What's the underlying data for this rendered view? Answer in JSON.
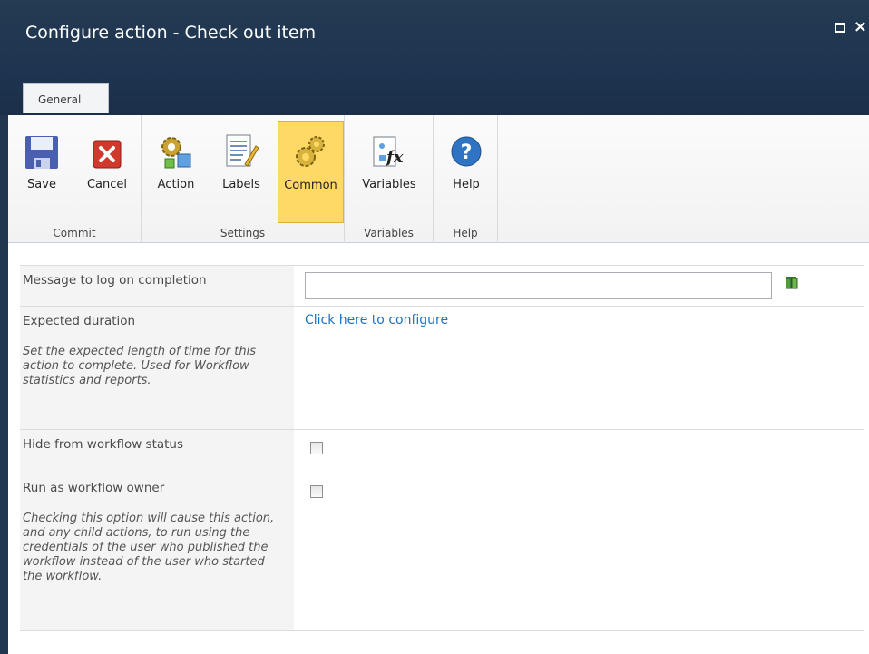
{
  "dialog": {
    "title": "Configure action - Check out item",
    "tab_label": "General",
    "window_controls": {
      "maximize": "□",
      "close": "×"
    }
  },
  "ribbon": {
    "groups": [
      {
        "label": "Commit",
        "buttons": [
          {
            "label": "Save",
            "icon": "save-icon"
          },
          {
            "label": "Cancel",
            "icon": "cancel-icon"
          }
        ]
      },
      {
        "label": "Settings",
        "buttons": [
          {
            "label": "Action",
            "icon": "action-gear-icon"
          },
          {
            "label": "Labels",
            "icon": "labels-icon"
          },
          {
            "label": "Common",
            "icon": "common-gears-icon",
            "active": true
          }
        ]
      },
      {
        "label": "Variables",
        "buttons": [
          {
            "label": "Variables",
            "icon": "variables-fx-icon"
          }
        ]
      },
      {
        "label": "Help",
        "buttons": [
          {
            "label": "Help",
            "icon": "help-icon"
          }
        ]
      }
    ],
    "active_color": "#ffd966"
  },
  "form": {
    "message": {
      "label": "Message to log on completion",
      "value": "",
      "placeholder": ""
    },
    "duration": {
      "label": "Expected duration",
      "link": "Click here to configure",
      "description": "Set the expected length of time for this action to complete. Used for Workflow statistics and reports."
    },
    "hide": {
      "label": "Hide from workflow status",
      "checked": false
    },
    "run_as_owner": {
      "label": "Run as workflow owner",
      "checked": false,
      "description": "Checking this option will cause this action, and any child actions, to run using the credentials of the user who published the workflow instead of the user who started the workflow."
    }
  },
  "colors": {
    "header": "#1e3450",
    "link": "#1a73c4",
    "label_bg": "#f4f4f4"
  }
}
